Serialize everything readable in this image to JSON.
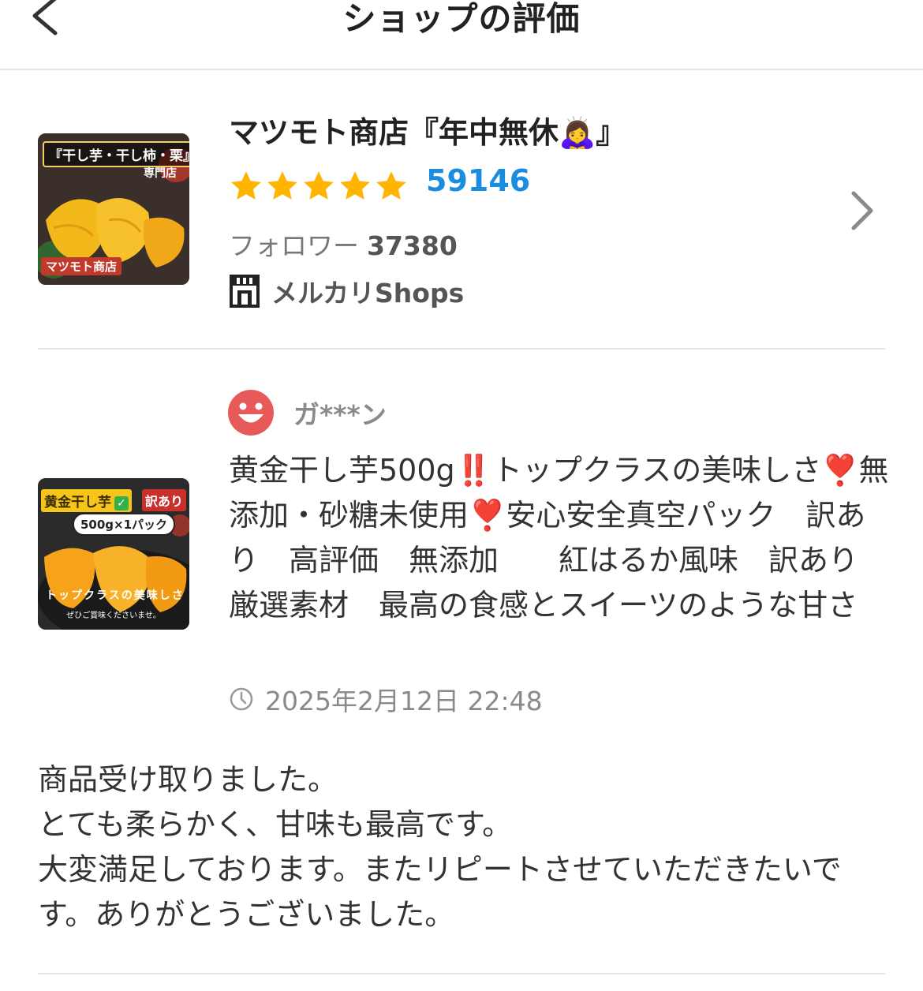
{
  "header": {
    "title": "ショップの評価",
    "back_icon": "chevron-left-icon"
  },
  "shop": {
    "name": "マツモト商店『年中無休🙇‍♀️』",
    "rating_stars": 5,
    "rating_count": "59146",
    "followers_label": "フォロワー",
    "followers_count": "37380",
    "platform_label": "メルカリShops",
    "thumbnail": {
      "banner": "『干し芋・干し柿・栗』",
      "sub": "専門店",
      "footer": "マツモト商店"
    },
    "colors": {
      "star": "#ffb400",
      "count": "#1a8de0"
    }
  },
  "review": {
    "reviewer_name": "ガ***ン",
    "item_title": "黄金干し芋500g‼️トップクラスの美味しさ❣️無添加・砂糖未使用❣️安心安全真空パック　訳あり　高評価　無添加　　紅はるか風味　訳あり　厳選素材　最高の食感とスイーツのような甘さ",
    "timestamp": "2025年2月12日 22:48",
    "comment": "商品受け取りました。\nとても柔らかく、甘味も最高です。\n大変満足しております。またリピートさせていただきたいです。ありがとうございました。",
    "thumbnail": {
      "banner": "黄金干し芋",
      "red_tag": "訳あり",
      "pack": "500g×1パック",
      "caption": "トップクラスの美味しさ",
      "small": "ぜひご賞味くださいませ。"
    }
  }
}
